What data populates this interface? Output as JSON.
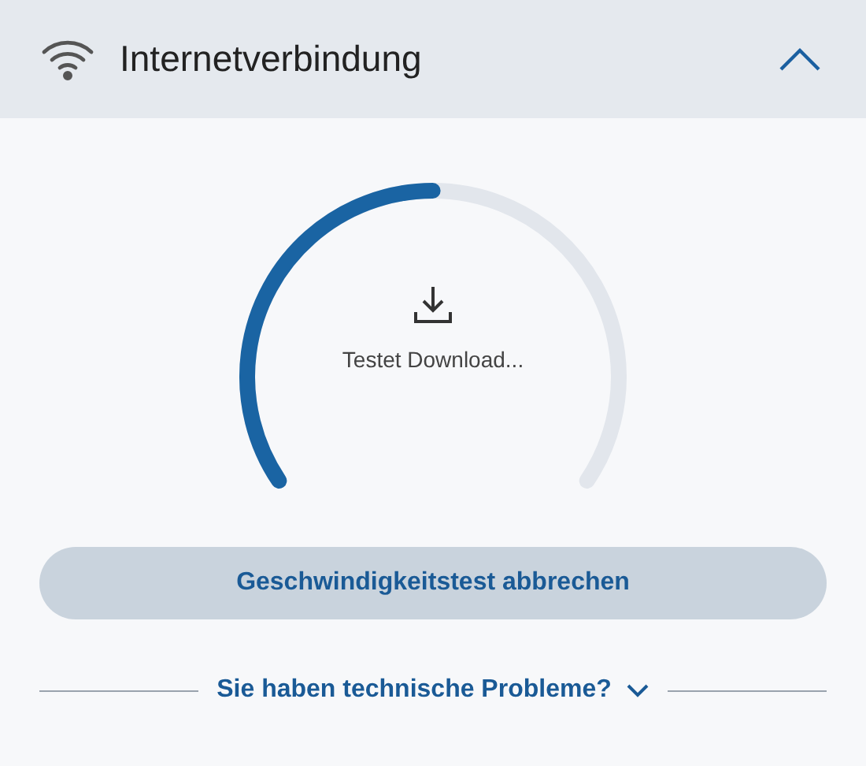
{
  "header": {
    "title": "Internetverbindung",
    "expanded": true
  },
  "gauge": {
    "status": "Testet Download..."
  },
  "cancel_button": {
    "label": "Geschwindigkeitstest abbrechen"
  },
  "help_link": {
    "label": "Sie haben technische Probleme?",
    "expanded": false
  }
}
